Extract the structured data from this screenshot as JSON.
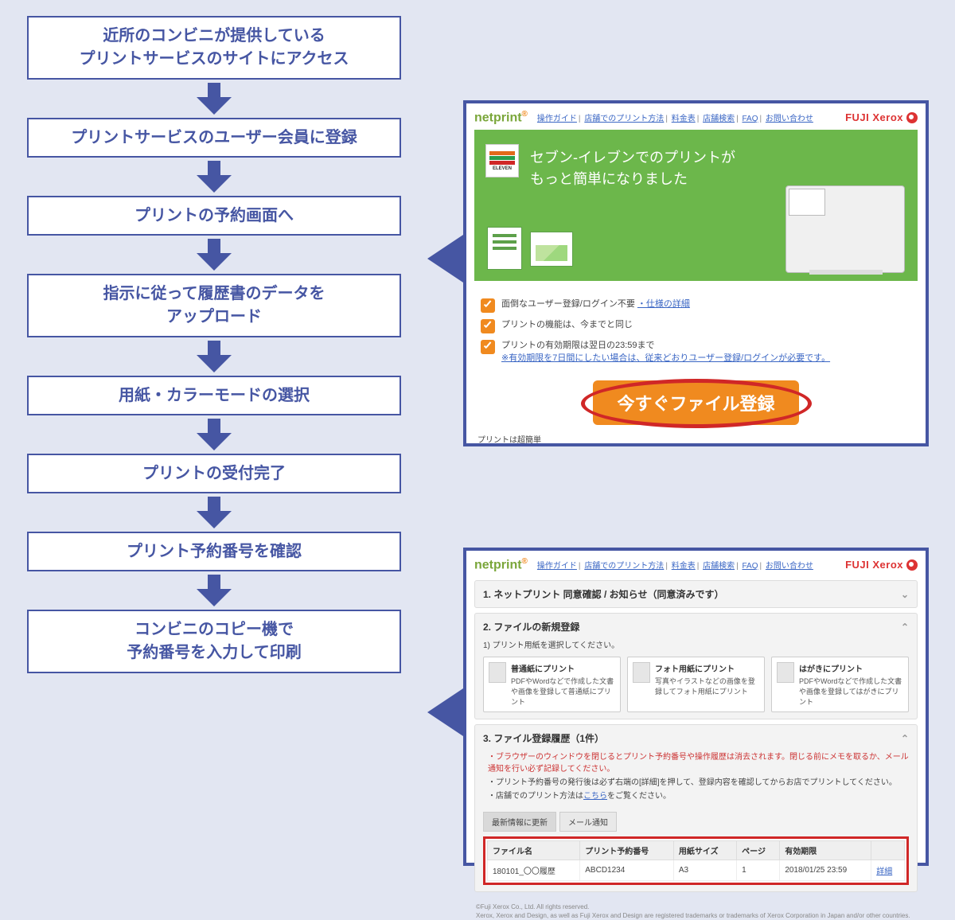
{
  "steps": [
    "近所のコンビニが提供している\nプリントサービスのサイトにアクセス",
    "プリントサービスのユーザー会員に登録",
    "プリントの予約画面へ",
    "指示に従って履歴書のデータを\nアップロード",
    "用紙・カラーモードの選択",
    "プリントの受付完了",
    "プリント予約番号を確認",
    "コンビニのコピー機で\n予約番号を入力して印刷"
  ],
  "shot1": {
    "logo": "netprint",
    "nav": [
      "操作ガイド",
      "店舗でのプリント方法",
      "料金表",
      "店舗検索",
      "FAQ",
      "お問い合わせ"
    ],
    "brand": "FUJI Xerox",
    "hero_line1": "セブン‐イレブンでのプリントが",
    "hero_line2": "もっと簡単になりました",
    "seven_label": "ELEVEN",
    "items": [
      {
        "text": "面倒なユーザー登録/ログイン不要",
        "link": "・仕様の詳細"
      },
      {
        "text": "プリントの機能は、今までと同じ",
        "link": ""
      },
      {
        "text": "プリントの有効期限は翌日の23:59まで",
        "link": "※有効期限を7日間にしたい場合は、従来どおりユーザー登録/ログインが必要です。"
      }
    ],
    "cta": "今すぐファイル登録",
    "footer": "プリントは超簡単"
  },
  "shot2": {
    "logo": "netprint",
    "nav": [
      "操作ガイド",
      "店舗でのプリント方法",
      "料金表",
      "店舗検索",
      "FAQ",
      "お問い合わせ"
    ],
    "brand": "FUJI Xerox",
    "panel1_title": "1. ネットプリント 同意確認 / お知らせ（同意済みです）",
    "panel2_title": "2. ファイルの新規登録",
    "panel2_sub": "1) プリント用紙を選択してください。",
    "opts": [
      {
        "title": "普通紙にプリント",
        "desc": "PDFやWordなどで作成した文書や画像を登録して普通紙にプリント"
      },
      {
        "title": "フォト用紙にプリント",
        "desc": "写真やイラストなどの画像を登録してフォト用紙にプリント"
      },
      {
        "title": "はがきにプリント",
        "desc": "PDFやWordなどで作成した文書や画像を登録してはがきにプリント"
      }
    ],
    "panel3_title": "3. ファイル登録履歴（1件）",
    "bullets": [
      "ブラウザーのウィンドウを閉じるとプリント予約番号や操作履歴は消去されます。閉じる前にメモを取るか、メール通知を行い必ず記録してください。",
      "プリント予約番号の発行後は必ず右端の[詳細]を押して、登録内容を確認してからお店でプリントしてください。",
      "店舗でのプリント方法は<こちら>をご覧ください。"
    ],
    "tabs": [
      "最新情報に更新",
      "メール通知"
    ],
    "table": {
      "headers": [
        "ファイル名",
        "プリント予約番号",
        "用紙サイズ",
        "ページ",
        "有効期限",
        ""
      ],
      "row": [
        "180101_〇〇履歴",
        "ABCD1234",
        "A3",
        "1",
        "2018/01/25 23:59",
        "詳細"
      ]
    },
    "foot1": "©Fuji Xerox Co., Ltd. All rights reserved.",
    "foot2": "Xerox, Xerox and Design, as well as Fuji Xerox and Design are registered trademarks or trademarks of Xerox Corporation in Japan and/or other countries."
  }
}
